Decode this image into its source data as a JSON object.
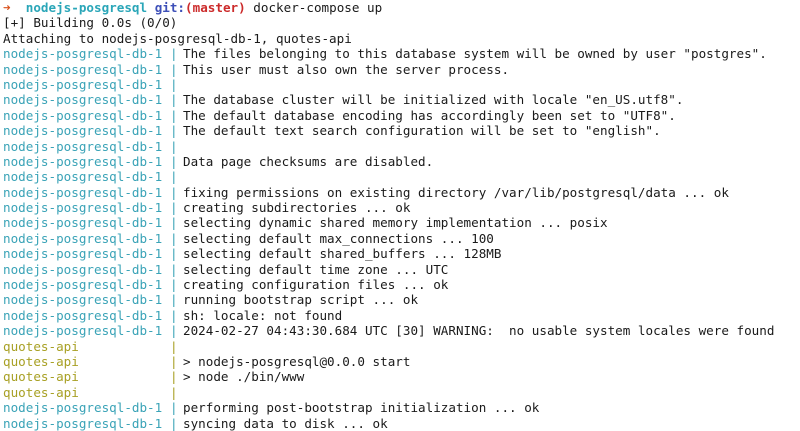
{
  "prompt": {
    "arrow": "➜",
    "directory": "nodejs-posgresql",
    "git_label": "git:",
    "branch": "(master)",
    "command": "docker-compose up"
  },
  "header_lines": [
    "[+] Building 0.0s (0/0)",
    "Attaching to nodejs-posgresql-db-1, quotes-api"
  ],
  "separator": "|",
  "log_lines": [
    {
      "service": "nodejs-posgresql-db-1",
      "kind": "db",
      "text": "The files belonging to this database system will be owned by user \"postgres\"."
    },
    {
      "service": "nodejs-posgresql-db-1",
      "kind": "db",
      "text": "This user must also own the server process."
    },
    {
      "service": "nodejs-posgresql-db-1",
      "kind": "db",
      "text": ""
    },
    {
      "service": "nodejs-posgresql-db-1",
      "kind": "db",
      "text": "The database cluster will be initialized with locale \"en_US.utf8\"."
    },
    {
      "service": "nodejs-posgresql-db-1",
      "kind": "db",
      "text": "The default database encoding has accordingly been set to \"UTF8\"."
    },
    {
      "service": "nodejs-posgresql-db-1",
      "kind": "db",
      "text": "The default text search configuration will be set to \"english\"."
    },
    {
      "service": "nodejs-posgresql-db-1",
      "kind": "db",
      "text": ""
    },
    {
      "service": "nodejs-posgresql-db-1",
      "kind": "db",
      "text": "Data page checksums are disabled."
    },
    {
      "service": "nodejs-posgresql-db-1",
      "kind": "db",
      "text": ""
    },
    {
      "service": "nodejs-posgresql-db-1",
      "kind": "db",
      "text": "fixing permissions on existing directory /var/lib/postgresql/data ... ok"
    },
    {
      "service": "nodejs-posgresql-db-1",
      "kind": "db",
      "text": "creating subdirectories ... ok"
    },
    {
      "service": "nodejs-posgresql-db-1",
      "kind": "db",
      "text": "selecting dynamic shared memory implementation ... posix"
    },
    {
      "service": "nodejs-posgresql-db-1",
      "kind": "db",
      "text": "selecting default max_connections ... 100"
    },
    {
      "service": "nodejs-posgresql-db-1",
      "kind": "db",
      "text": "selecting default shared_buffers ... 128MB"
    },
    {
      "service": "nodejs-posgresql-db-1",
      "kind": "db",
      "text": "selecting default time zone ... UTC"
    },
    {
      "service": "nodejs-posgresql-db-1",
      "kind": "db",
      "text": "creating configuration files ... ok"
    },
    {
      "service": "nodejs-posgresql-db-1",
      "kind": "db",
      "text": "running bootstrap script ... ok"
    },
    {
      "service": "nodejs-posgresql-db-1",
      "kind": "db",
      "text": "sh: locale: not found"
    },
    {
      "service": "nodejs-posgresql-db-1",
      "kind": "db",
      "text": "2024-02-27 04:43:30.684 UTC [30] WARNING:  no usable system locales were found"
    },
    {
      "service": "quotes-api",
      "kind": "api",
      "text": ""
    },
    {
      "service": "quotes-api",
      "kind": "api",
      "text": "> nodejs-posgresql@0.0.0 start"
    },
    {
      "service": "quotes-api",
      "kind": "api",
      "text": "> node ./bin/www"
    },
    {
      "service": "quotes-api",
      "kind": "api",
      "text": ""
    },
    {
      "service": "nodejs-posgresql-db-1",
      "kind": "db",
      "text": "performing post-bootstrap initialization ... ok"
    },
    {
      "service": "nodejs-posgresql-db-1",
      "kind": "db",
      "text": "syncing data to disk ... ok"
    }
  ],
  "colors": {
    "db_service": "#3aa3b7",
    "api_service": "#a8a024",
    "prompt_arrow": "#d9531e",
    "prompt_dir": "#2aa6b8",
    "git_label": "#3d4fb8",
    "branch": "#cc2b2b"
  }
}
